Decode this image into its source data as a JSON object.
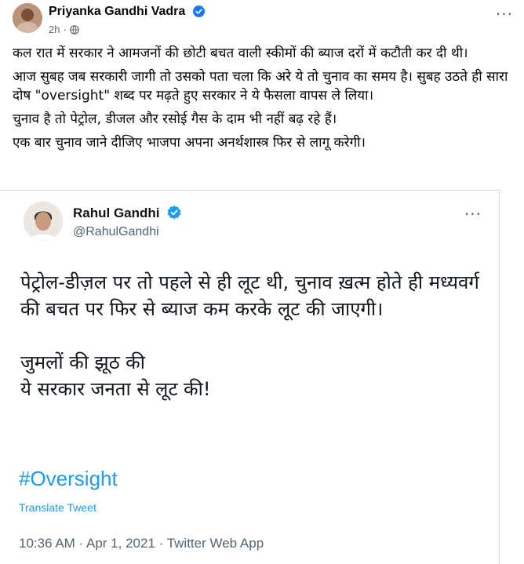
{
  "facebook_post": {
    "author": "Priyanka Gandhi Vadra",
    "time": "2h",
    "separator": "·",
    "more_label": "···",
    "paragraphs": [
      "कल रात में सरकार ने आमजनों की छोटी बचत वाली स्कीमों की ब्याज दरों में कटौती कर दी थी।",
      "आज सुबह जब सरकारी जागी तो उसको पता चला कि अरे ये तो चुनाव का समय है। सुबह उठते ही सारा दोष \"oversight\" शब्द पर मढ़ते हुए सरकार ने ये फैसला वापस ले लिया।",
      "चुनाव है तो पेट्रोल, डीजल और रसोई गैस के दाम भी नहीं बढ़ रहे हैं।",
      "एक बार चुनाव जाने दीजिए भाजपा अपना अनर्थशास्त्र फिर से लागू करेगी।"
    ],
    "icons": {
      "verified": "verified-badge-icon",
      "audience": "globe-icon",
      "menu": "more-icon"
    },
    "colors": {
      "verified": "#1877f2",
      "meta": "#65676b"
    }
  },
  "tweet": {
    "name": "Rahul Gandhi",
    "handle": "@RahulGandhi",
    "more_label": "···",
    "paragraph1": "पेट्रोल-डीज़ल पर तो पहले से ही लूट थी, चुनाव ख़त्म होते ही मध्यवर्ग की बचत पर फिर से ब्याज कम करके लूट की जाएगी।",
    "line2": "जुमलों की झूठ की",
    "line3": "ये सरकार जनता से लूट की!",
    "hashtag": "#Oversight",
    "translate": "Translate Tweet",
    "timestamp": "10:36 AM · Apr 1, 2021 · Twitter Web App",
    "icons": {
      "verified": "verified-badge-icon",
      "menu": "more-icon"
    },
    "colors": {
      "verified": "#1d9bf0",
      "link": "#1d9bf0",
      "meta": "#536471"
    }
  }
}
